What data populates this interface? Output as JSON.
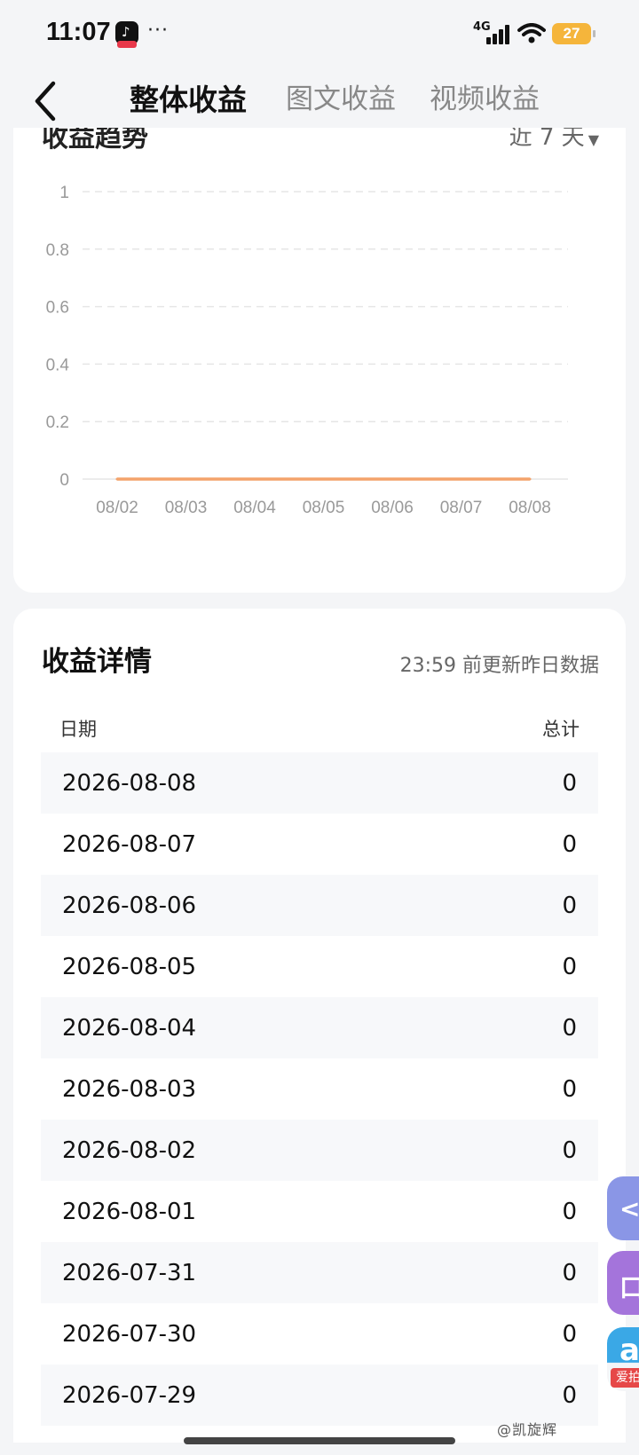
{
  "status_bar": {
    "time": "11:07",
    "dots": "···",
    "network": "4G",
    "battery": "27"
  },
  "header": {
    "tabs": [
      {
        "label": "整体收益",
        "active": true
      },
      {
        "label": "图文收益",
        "active": false
      },
      {
        "label": "视频收益",
        "active": false
      }
    ]
  },
  "trend_card": {
    "title": "收益趋势",
    "range_label": "近 7 天"
  },
  "chart_data": {
    "type": "line",
    "x": [
      "08/02",
      "08/03",
      "08/04",
      "08/05",
      "08/06",
      "08/07",
      "08/08"
    ],
    "series": [
      {
        "values": [
          0,
          0,
          0,
          0,
          0,
          0,
          0
        ],
        "color": "#f4a36b"
      }
    ],
    "yticks": [
      "0",
      "0.2",
      "0.4",
      "0.6",
      "0.8",
      "1"
    ],
    "ylim": [
      0,
      1
    ],
    "grid": true,
    "grid_style": "dashed"
  },
  "details_card": {
    "title": "收益详情",
    "note": "23:59 前更新昨日数据",
    "columns": {
      "date": "日期",
      "total": "总计"
    },
    "rows": [
      {
        "date": "2026-08-08",
        "total": "0"
      },
      {
        "date": "2026-08-07",
        "total": "0"
      },
      {
        "date": "2026-08-06",
        "total": "0"
      },
      {
        "date": "2026-08-05",
        "total": "0"
      },
      {
        "date": "2026-08-04",
        "total": "0"
      },
      {
        "date": "2026-08-03",
        "total": "0"
      },
      {
        "date": "2026-08-02",
        "total": "0"
      },
      {
        "date": "2026-08-01",
        "total": "0"
      },
      {
        "date": "2026-07-31",
        "total": "0"
      },
      {
        "date": "2026-07-30",
        "total": "0"
      },
      {
        "date": "2026-07-29",
        "total": "0"
      }
    ]
  },
  "float_buttons": {
    "third_label": "爱拍"
  },
  "watermark": "@凯旋辉"
}
